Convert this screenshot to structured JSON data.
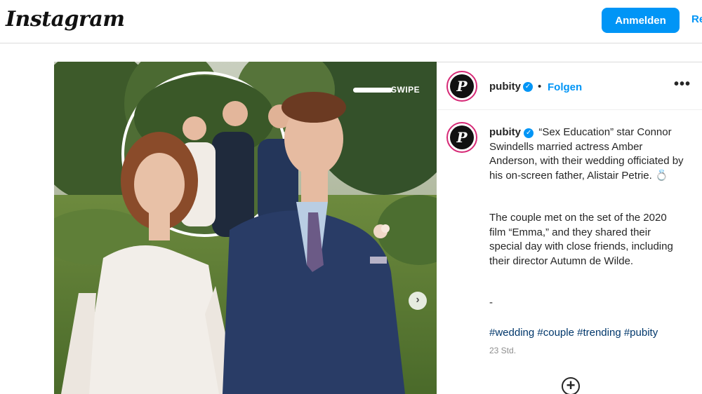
{
  "header": {
    "logo": "Instagram",
    "login_label": "Anmelden",
    "register_label": "Re"
  },
  "post": {
    "username": "pubity",
    "avatar_letter": "P",
    "follow_label": "Folgen",
    "separator": "•",
    "more_icon": "more-options-icon",
    "verified_icon": "verified-badge-icon",
    "media": {
      "overlay_text": "SWIPE",
      "next_icon": "›"
    },
    "caption": {
      "username": "pubity",
      "paragraph1": "“Sex Education” star Connor Swindells married actress Amber Anderson, with their wedding officiated by his on-screen father, Alistair Petrie. 💍",
      "paragraph2": "The couple met on the set of the 2020 film “Emma,” and they shared their special day with close friends, including their director Autumn de Wilde.",
      "dash": "-",
      "hashtags": [
        "#wedding",
        "#couple",
        "#trending",
        "#pubity"
      ]
    },
    "timestamp": "23 Std."
  },
  "colors": {
    "accent": "#0095f6",
    "hashtag": "#00376b",
    "story_ring": "#d62976"
  }
}
